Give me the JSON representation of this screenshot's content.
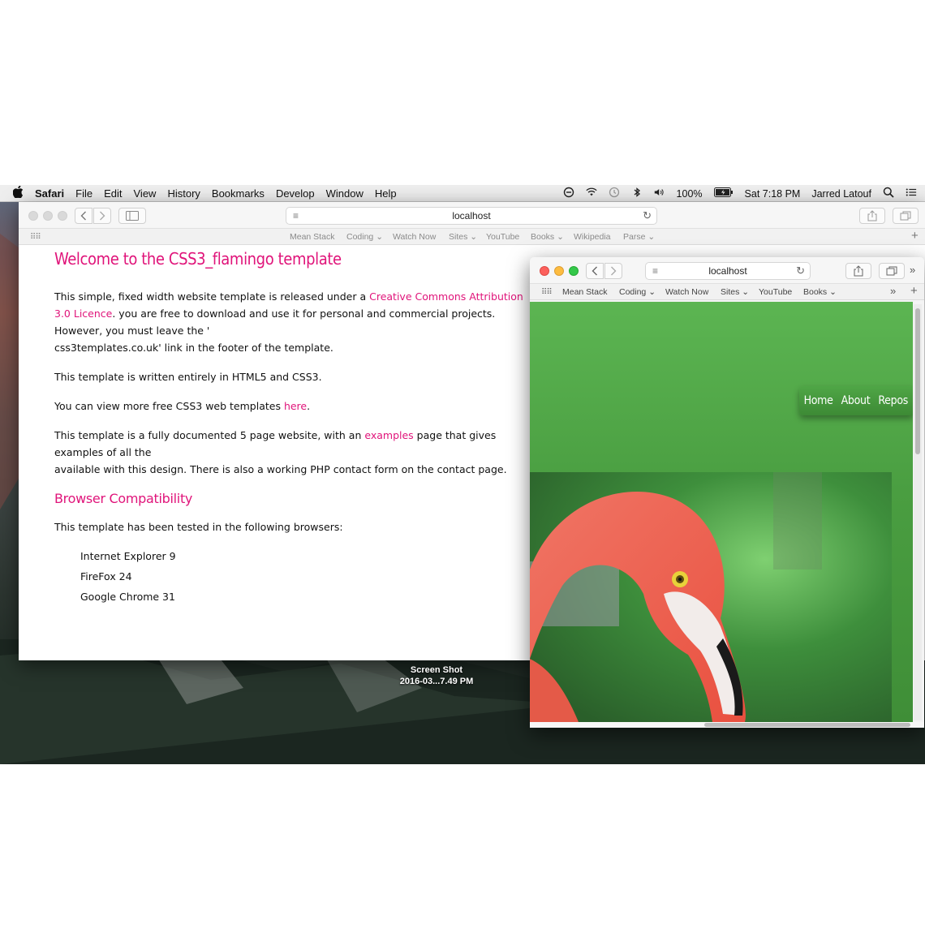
{
  "menubar": {
    "apple": "",
    "app_name": "Safari",
    "menus": [
      "File",
      "Edit",
      "View",
      "History",
      "Bookmarks",
      "Develop",
      "Window",
      "Help"
    ],
    "battery": "100%",
    "clock": "Sat 7:18 PM",
    "user": "Jarred Latouf"
  },
  "window_main": {
    "address": "localhost",
    "favorites": [
      "Mean Stack",
      "Coding ⌄",
      "Watch Now",
      "Sites ⌄",
      "YouTube",
      "Books ⌄",
      "Wikipedia",
      "Parse ⌄"
    ],
    "page": {
      "heading": "Welcome to the CSS3_flamingo template",
      "p1_a": "This simple, fixed width website template is released under a ",
      "p1_link": "Creative Commons Attribution 3.0 Licence",
      "p1_b": ". you are free to download and use it for personal and commercial projects. However, you must leave the '",
      "p1_c": "css3templates.co.uk' link in the footer of the template.",
      "p2": "This template is written entirely in HTML5 and CSS3.",
      "p3_a": "You can view more free CSS3 web templates ",
      "p3_link": "here",
      "p3_b": ".",
      "p4_a": "This template is a fully documented 5 page website, with an ",
      "p4_link": "examples",
      "p4_b": " page that gives examples of all the",
      "p4_c": "available with this design. There is also a working PHP contact form on the contact page.",
      "subheading": "Browser Compatibility",
      "p5": "This template has been tested in the following browsers:",
      "browsers": [
        "Internet Explorer 9",
        "FireFox 24",
        "Google Chrome 31"
      ]
    }
  },
  "desktop_file": {
    "line1": "Screen Shot",
    "line2": "2016-03...7.49 PM"
  },
  "window_small": {
    "address": "localhost",
    "favorites": [
      "Mean Stack",
      "Coding ⌄",
      "Watch Now",
      "Sites ⌄",
      "YouTube",
      "Books ⌄"
    ],
    "nav": [
      "Home",
      "About",
      "Repos"
    ]
  },
  "colors": {
    "accent_pink": "#e0147a",
    "green_header": "#4a9e41"
  }
}
